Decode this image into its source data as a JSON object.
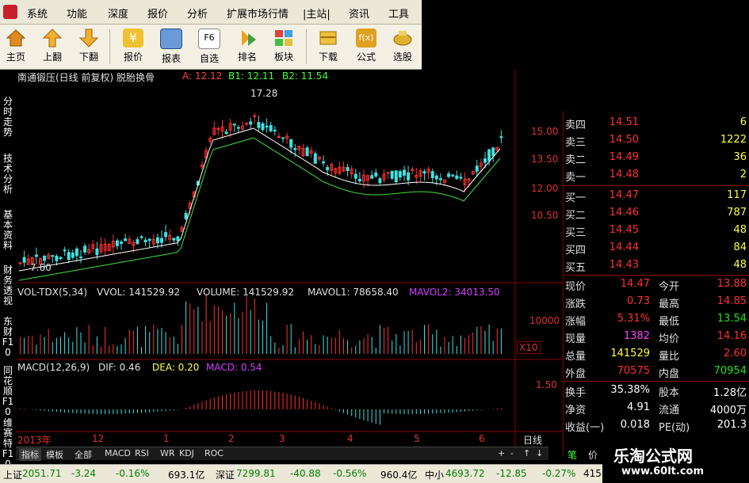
{
  "menu": [
    "系统",
    "功能",
    "深度",
    "报价",
    "分析",
    "扩展市场行情",
    "|主站|",
    "资讯",
    "工具"
  ],
  "toolbar": [
    "主页",
    "上翻",
    "下翻",
    "报价",
    "报表",
    "自选",
    "排名",
    "板块",
    "下载",
    "公式",
    "选股"
  ],
  "toolbar_f6": "F6",
  "sidetabs": [
    "分时走势",
    "技术分析",
    "基本资料",
    "财务透视",
    "东财F10",
    "同花顺F10",
    "维赛特F10"
  ],
  "chart": {
    "title": "南通锻压(日线 前复权) 脱胎换骨",
    "a": "A: 12.12",
    "b1": "B1: 12.11",
    "b2": "B2: 11.54",
    "peak": "17.28",
    "low": "7.60",
    "prices": [
      "15.00",
      "13.50",
      "12.00",
      "10.50"
    ],
    "vol_header": "VOL-TDX(5,34)",
    "vvol": "VVOL: 141529.92",
    "volume": "VOLUME: 141529.92",
    "mavol1": "MAVOL1: 78658.40",
    "mavol2": "MAVOL2: 34013.50",
    "vol_scale": "10000",
    "vol_unit": "X10",
    "macd_header": "MACD(12,26,9)",
    "dif": "DIF: 0.46",
    "dea": "DEA: 0.20",
    "macd": "MACD: 0.54",
    "macd_scale": "1.50",
    "dates": [
      "2013年",
      "12",
      "1",
      "2",
      "3",
      "4",
      "5",
      "6"
    ],
    "period": "日线"
  },
  "quote": {
    "sells": [
      [
        "卖四",
        "14.51",
        "6"
      ],
      [
        "卖三",
        "14.50",
        "1222"
      ],
      [
        "卖二",
        "14.49",
        "36"
      ],
      [
        "卖一",
        "14.48",
        "2"
      ]
    ],
    "buys": [
      [
        "买一",
        "14.47",
        "117"
      ],
      [
        "买二",
        "14.46",
        "787"
      ],
      [
        "买三",
        "14.45",
        "48"
      ],
      [
        "买四",
        "14.44",
        "84"
      ],
      [
        "买五",
        "14.43",
        "48"
      ]
    ],
    "stats": [
      [
        "现价",
        "14.47",
        "今开",
        "13.88"
      ],
      [
        "涨跌",
        "0.73",
        "最高",
        "14.85"
      ],
      [
        "涨幅",
        "5.31%",
        "最低",
        "13.54"
      ],
      [
        "现量",
        "1382",
        "均价",
        "14.16"
      ],
      [
        "总量",
        "141529",
        "量比",
        "2.60"
      ],
      [
        "外盘",
        "70575",
        "内盘",
        "70954"
      ],
      [
        "换手",
        "35.38%",
        "股本",
        "1.28亿"
      ],
      [
        "净资",
        "4.91",
        "流通",
        "4000万"
      ],
      [
        "收益(一)",
        "0.018",
        "PE(动)",
        "201.3"
      ]
    ]
  },
  "tabs": [
    "指标",
    "模板",
    "全部",
    "MACD",
    "RSI",
    "WR",
    "KDJ",
    "ROC"
  ],
  "tab_right": [
    "+",
    "-",
    "↑",
    "↓",
    "笔",
    "价"
  ],
  "status": {
    "sh_label": "上证",
    "sh_value": "2051.71",
    "sh_chg": "-3.24",
    "sh_pct": "-0.16%",
    "sh_amt": "693.1亿",
    "sz_label": "深证",
    "sz_value": "7299.81",
    "sz_chg": "-40.88",
    "sz_pct": "-0.56%",
    "sz_amt": "960.4亿",
    "zx_label": "中小",
    "zx_value": "4693.72",
    "zx_chg": "-12.85",
    "zx_pct": "-0.27%",
    "zx_amt": "415"
  },
  "watermark": {
    "title": "乐淘公式网",
    "url": "www.60lt.com"
  }
}
